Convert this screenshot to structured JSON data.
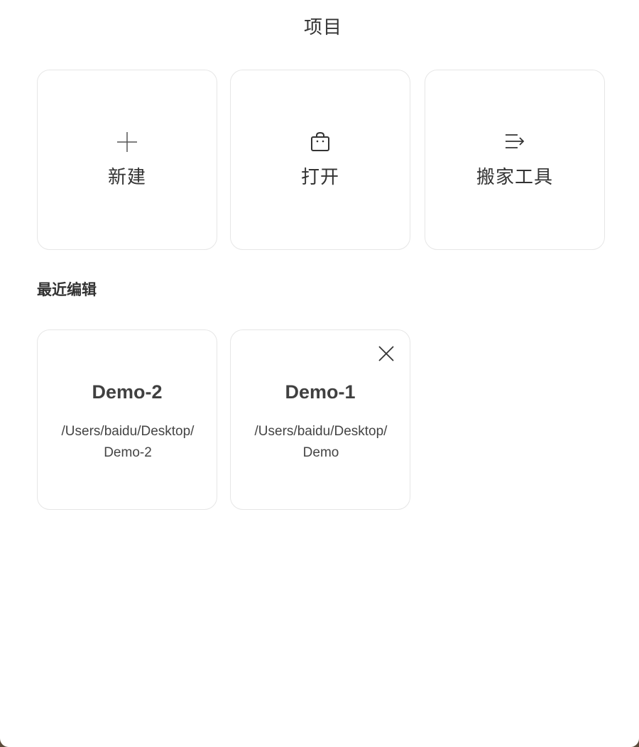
{
  "header": {
    "title": "项目"
  },
  "actions": [
    {
      "label": "新建",
      "icon": "plus-icon"
    },
    {
      "label": "打开",
      "icon": "bag-icon"
    },
    {
      "label": "搬家工具",
      "icon": "migrate-icon"
    }
  ],
  "recent": {
    "title": "最近编辑",
    "items": [
      {
        "name": "Demo-2",
        "path": "/Users/baidu/Desktop/Demo-2"
      },
      {
        "name": "Demo-1",
        "path": "/Users/baidu/Desktop/Demo"
      }
    ]
  },
  "colors": {
    "text": "#333333",
    "border": "#e6e6e6",
    "background": "#ffffff"
  }
}
